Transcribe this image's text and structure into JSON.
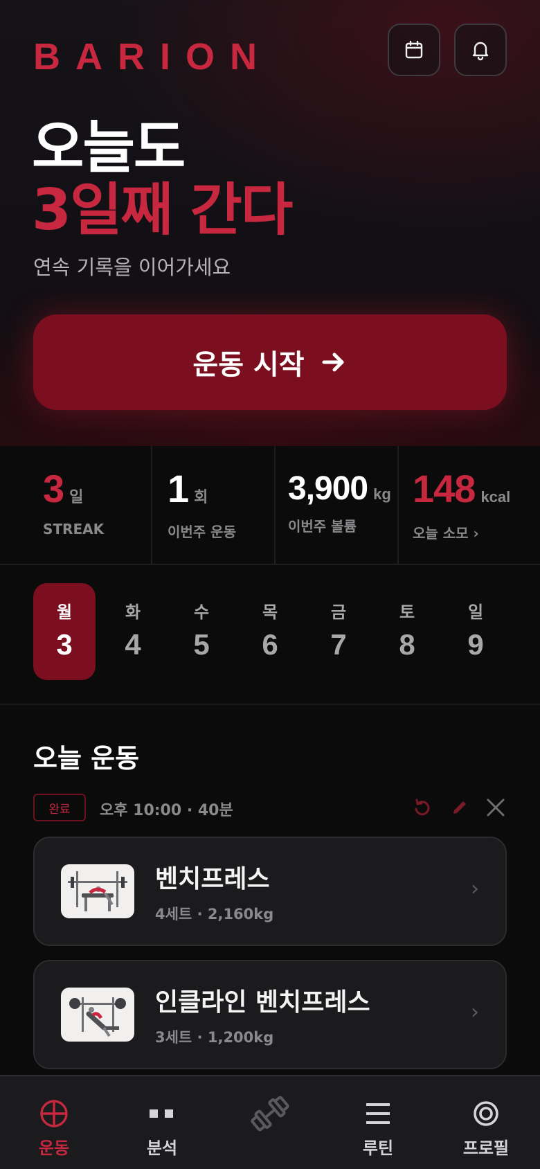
{
  "colors": {
    "accent": "#c8283f",
    "accent_dark": "#7c0f1f",
    "background": "#0b0b0c",
    "card": "#1b1b1d"
  },
  "header": {
    "logo": "BARION",
    "calendar_icon": "calendar-icon",
    "bell_icon": "bell-icon"
  },
  "hero": {
    "line1": "오늘도",
    "line2": "3일째 간다",
    "subtitle": "연속 기록을 이어가세요",
    "start_label": "운동 시작",
    "start_icon": "arrow-right-icon"
  },
  "stats": [
    {
      "value": "3",
      "unit": "일",
      "caption": "STREAK"
    },
    {
      "value": "1",
      "unit": "회",
      "caption": "이번주 운동"
    },
    {
      "value": "3,900",
      "unit": "kg",
      "caption": "이번주 볼륨"
    },
    {
      "value": "148",
      "unit": "kcal",
      "caption": "오늘 소모 ›"
    }
  ],
  "week": [
    {
      "day": "월",
      "date": "3",
      "active": true
    },
    {
      "day": "화",
      "date": "4"
    },
    {
      "day": "수",
      "date": "5"
    },
    {
      "day": "목",
      "date": "6"
    },
    {
      "day": "금",
      "date": "7"
    },
    {
      "day": "토",
      "date": "8"
    },
    {
      "day": "일",
      "date": "9"
    }
  ],
  "today": {
    "title": "오늘 운동",
    "status_badge": "완료",
    "session_meta": "오후 10:00 · 40분",
    "actions": [
      "undo-icon",
      "edit-icon",
      "close-icon"
    ],
    "exercises": [
      {
        "name": "벤치프레스",
        "detail": "4세트 · 2,160kg",
        "thumb": "bench-press-thumbnail"
      },
      {
        "name": "인클라인 벤치프레스",
        "detail": "3세트 · 1,200kg",
        "thumb": "incline-bench-press-thumbnail"
      }
    ]
  },
  "nav": [
    {
      "label": "운동",
      "icon": "crosshair-icon",
      "active": true
    },
    {
      "label": "분석",
      "icon": "bars-icon"
    },
    {
      "label": "",
      "icon": "dumbbell-icon"
    },
    {
      "label": "루틴",
      "icon": "list-icon"
    },
    {
      "label": "프로필",
      "icon": "profile-ring-icon"
    }
  ]
}
